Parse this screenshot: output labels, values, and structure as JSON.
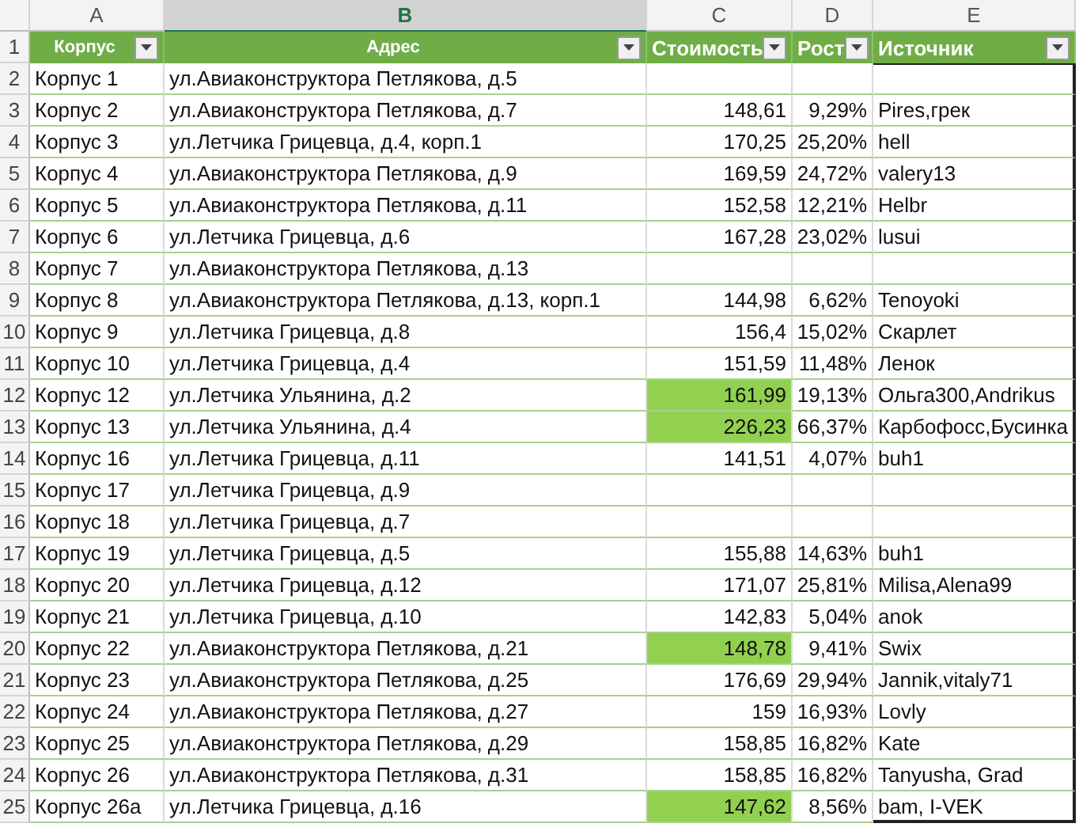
{
  "columns": [
    {
      "letter": "A",
      "selected": false
    },
    {
      "letter": "B",
      "selected": true
    },
    {
      "letter": "C",
      "selected": false
    },
    {
      "letter": "D",
      "selected": false
    },
    {
      "letter": "E",
      "selected": false
    }
  ],
  "header": {
    "row": "1",
    "cells": [
      {
        "label": "Корпус"
      },
      {
        "label": "Адрес"
      },
      {
        "label": "Стоимость"
      },
      {
        "label": "Рост"
      },
      {
        "label": "Источник"
      }
    ]
  },
  "rows": [
    {
      "row": "2",
      "building": "Корпус 1",
      "address": "ул.Авиаконструктора Петлякова, д.5"
    },
    {
      "row": "3",
      "building": "Корпус 2",
      "address": "ул.Авиаконструктора Петлякова, д.7",
      "cost": "148,61",
      "growth": "9,29%",
      "source": "Pires,грек",
      "highlighted": false
    },
    {
      "row": "4",
      "building": "Корпус 3",
      "address": "ул.Летчика Грицевца, д.4, корп.1",
      "cost": "170,25",
      "growth": "25,20%",
      "source": "hell",
      "highlighted": false
    },
    {
      "row": "5",
      "building": "Корпус 4",
      "address": "ул.Авиаконструктора Петлякова, д.9",
      "cost": "169,59",
      "growth": "24,72%",
      "source": "valery13",
      "highlighted": false
    },
    {
      "row": "6",
      "building": "Корпус 5",
      "address": "ул.Авиаконструктора Петлякова, д.11",
      "cost": "152,58",
      "growth": "12,21%",
      "source": "Helbr",
      "highlighted": false
    },
    {
      "row": "7",
      "building": "Корпус 6",
      "address": "ул.Летчика Грицевца, д.6",
      "cost": "167,28",
      "growth": "23,02%",
      "source": "lusui",
      "highlighted": false
    },
    {
      "row": "8",
      "building": "Корпус 7",
      "address": "ул.Авиаконструктора Петлякова, д.13"
    },
    {
      "row": "9",
      "building": "Корпус 8",
      "address": "ул.Авиаконструктора Петлякова, д.13, корп.1",
      "cost": "144,98",
      "growth": "6,62%",
      "source": "Tenoyoki",
      "highlighted": false
    },
    {
      "row": "10",
      "building": "Корпус 9",
      "address": "ул.Летчика Грицевца, д.8",
      "cost": "156,4",
      "growth": "15,02%",
      "source": "Скарлет",
      "highlighted": false
    },
    {
      "row": "11",
      "building": "Корпус 10",
      "address": "ул.Летчика Грицевца, д.4",
      "cost": "151,59",
      "growth": "11,48%",
      "source": "Ленок",
      "highlighted": false
    },
    {
      "row": "12",
      "building": "Корпус 12",
      "address": "ул.Летчика Ульянина, д.2",
      "cost": "161,99",
      "growth": "19,13%",
      "source": "Ольга300,Andrikus",
      "highlighted": true
    },
    {
      "row": "13",
      "building": "Корпус 13",
      "address": "ул.Летчика Ульянина, д.4",
      "cost": "226,23",
      "growth": "66,37%",
      "source": "Карбофосс,Бусинка",
      "highlighted": true
    },
    {
      "row": "14",
      "building": "Корпус 16",
      "address": "ул.Летчика Грицевца, д.11",
      "cost": "141,51",
      "growth": "4,07%",
      "source": "buh1",
      "highlighted": false
    },
    {
      "row": "15",
      "building": "Корпус 17",
      "address": "ул.Летчика Грицевца, д.9"
    },
    {
      "row": "16",
      "building": "Корпус 18",
      "address": "ул.Летчика Грицевца, д.7"
    },
    {
      "row": "17",
      "building": "Корпус 19",
      "address": "ул.Летчика Грицевца, д.5",
      "cost": "155,88",
      "growth": "14,63%",
      "source": "buh1",
      "highlighted": false
    },
    {
      "row": "18",
      "building": "Корпус 20",
      "address": "ул.Летчика Грицевца, д.12",
      "cost": "171,07",
      "growth": "25,81%",
      "source": "Milisa,Alena99",
      "highlighted": false
    },
    {
      "row": "19",
      "building": "Корпус 21",
      "address": "ул.Летчика Грицевца, д.10",
      "cost": "142,83",
      "growth": "5,04%",
      "source": "anok",
      "highlighted": false
    },
    {
      "row": "20",
      "building": "Корпус 22",
      "address": "ул.Авиаконструктора Петлякова, д.21",
      "cost": "148,78",
      "growth": "9,41%",
      "source": "Swix",
      "highlighted": true
    },
    {
      "row": "21",
      "building": "Корпус 23",
      "address": "ул.Авиаконструктора Петлякова, д.25",
      "cost": "176,69",
      "growth": "29,94%",
      "source": "Jannik,vitaly71",
      "highlighted": false
    },
    {
      "row": "22",
      "building": "Корпус 24",
      "address": "ул.Авиаконструктора Петлякова, д.27",
      "cost": "159",
      "growth": "16,93%",
      "source": "Lovly",
      "highlighted": false
    },
    {
      "row": "23",
      "building": "Корпус 25",
      "address": "ул.Авиаконструктора Петлякова, д.29",
      "cost": "158,85",
      "growth": "16,82%",
      "source": "Kate",
      "highlighted": false
    },
    {
      "row": "24",
      "building": "Корпус 26",
      "address": "ул.Авиаконструктора Петлякова, д.31",
      "cost": "158,85",
      "growth": "16,82%",
      "source": "Tanyusha, Grad",
      "highlighted": false
    },
    {
      "row": "25",
      "building": "Корпус 26а",
      "address": "ул.Летчика Грицевца, д.16",
      "cost": "147,62",
      "growth": "8,56%",
      "source": "bam, I-VEK",
      "highlighted": true
    }
  ]
}
